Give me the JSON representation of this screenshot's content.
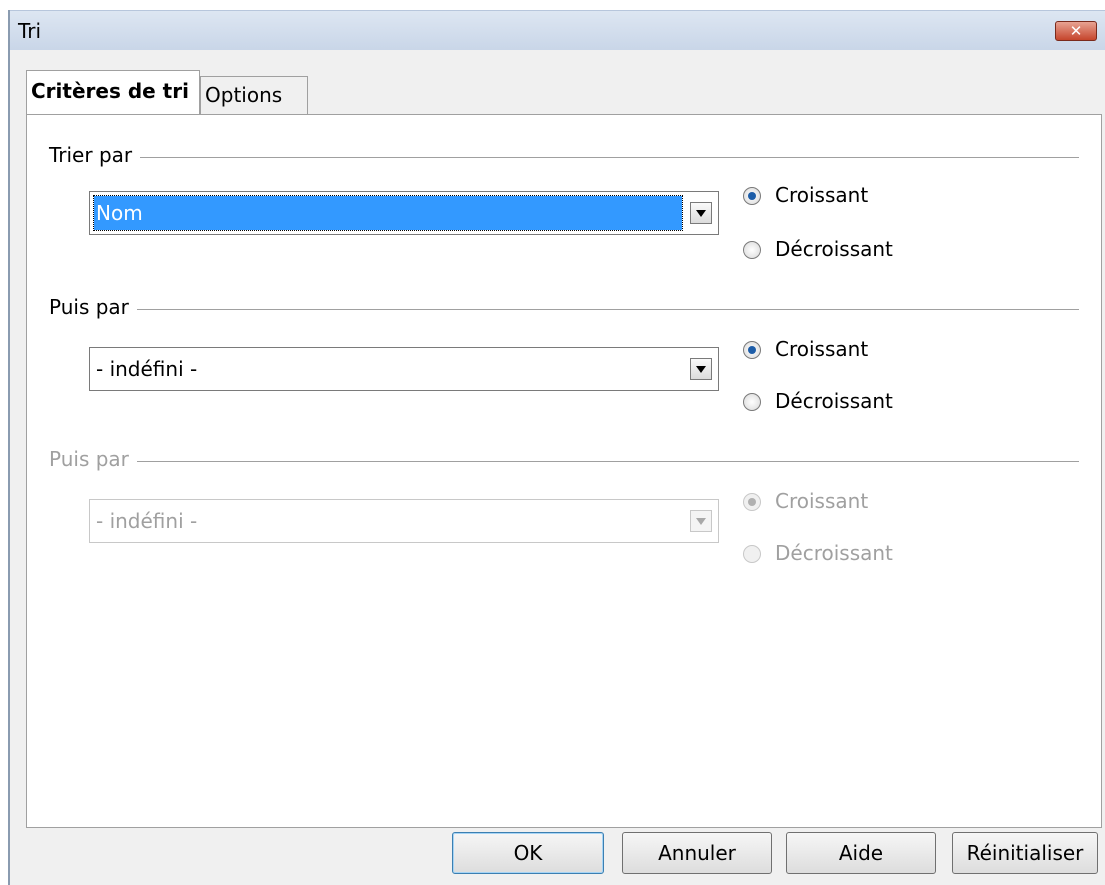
{
  "dialog": {
    "title": "Tri",
    "close_icon": "close-x-icon"
  },
  "tabs": [
    {
      "label": "Critères de tri",
      "active": true
    },
    {
      "label": "Options",
      "active": false
    }
  ],
  "groups": [
    {
      "legend": "Trier par",
      "select_value": "Nom",
      "enabled": true,
      "radios": [
        {
          "label": "Croissant",
          "checked": true
        },
        {
          "label": "Décroissant",
          "checked": false
        }
      ]
    },
    {
      "legend": "Puis par",
      "select_value": "- indéfini -",
      "enabled": true,
      "radios": [
        {
          "label": "Croissant",
          "checked": true
        },
        {
          "label": "Décroissant",
          "checked": false
        }
      ]
    },
    {
      "legend": "Puis par",
      "select_value": "- indéfini -",
      "enabled": false,
      "radios": [
        {
          "label": "Croissant",
          "checked": true
        },
        {
          "label": "Décroissant",
          "checked": false
        }
      ]
    }
  ],
  "buttons": {
    "ok": "OK",
    "cancel": "Annuler",
    "help": "Aide",
    "reset": "Réinitialiser"
  },
  "colors": {
    "selection": "#3399ff",
    "disabled_text": "#a0a0a0",
    "radio_dot": "#1d5da8"
  }
}
